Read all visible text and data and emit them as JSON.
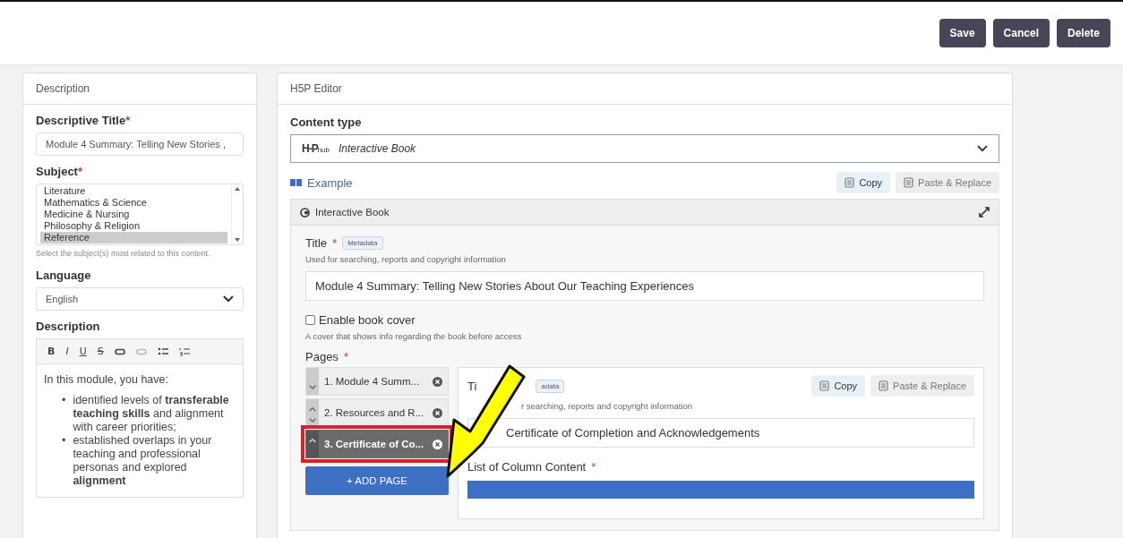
{
  "toolbar": {
    "buttons": [
      "Save",
      "Cancel",
      "Delete"
    ]
  },
  "description_panel": {
    "heading": "Description",
    "title_label": "Descriptive Title",
    "title_required": "*",
    "title_value": "Module 4 Summary: Telling New Stories ,",
    "subject_label": "Subject",
    "subject_required": "*",
    "subjects": [
      {
        "label": "Literature",
        "selected": false
      },
      {
        "label": "Mathematics & Science",
        "selected": false
      },
      {
        "label": "Medicine & Nursing",
        "selected": false
      },
      {
        "label": "Philosophy & Religion",
        "selected": false
      },
      {
        "label": "Reference",
        "selected": true
      }
    ],
    "subject_hint": "Select the subject(s) most related to this content.",
    "language_label": "Language",
    "language_value": "English",
    "description_label": "Description",
    "editor_buttons": [
      "B",
      "I",
      "U",
      "S"
    ],
    "intro": "In this module, you have:",
    "bullets": [
      {
        "marker": "•",
        "text": "identified levels of **transferable teaching skills** and alignment with career priorities;"
      },
      {
        "marker": "•",
        "text": "established overlaps in your teaching and professional personas and explored **alignment**"
      }
    ]
  },
  "editor_panel": {
    "heading": "H5P Editor",
    "content_type_label": "Content type",
    "hub_logo": "H-P",
    "hub_logo_sub": "hub",
    "content_type_value": "Interactive Book",
    "example_link": "Example",
    "copy": "Copy",
    "paste": "Paste & Replace",
    "library_title": "Interactive Book",
    "title_label": "Title",
    "title_required": "*",
    "metadata": "Metadata",
    "title_hint": "Used for searching, reports and copyright information",
    "title_value": "Module 4 Summary: Telling New Stories About Our Teaching Experiences",
    "cover_label": "Enable book cover",
    "cover_checked": false,
    "cover_hint": "A cover that shows info regarding the book before access",
    "pages_label": "Pages",
    "pages_required": "*",
    "pages": [
      {
        "label": "1. Module 4 Summ...",
        "selected": false,
        "highlighted": false
      },
      {
        "label": "2. Resources and R...",
        "selected": false,
        "highlighted": false
      },
      {
        "label": "3. Certificate of Co...",
        "selected": true,
        "highlighted": true
      }
    ],
    "add_page": "+ ADD PAGE",
    "page_form": {
      "title_label": "Ti",
      "metadata": "adata",
      "copy": "Copy",
      "paste": "Paste & Replace",
      "title_hint": "r searching, reports and copyright information",
      "title_value": "Certificate of Completion and Acknowledgements",
      "list_label": "List of Column Content",
      "list_required": "*"
    }
  }
}
